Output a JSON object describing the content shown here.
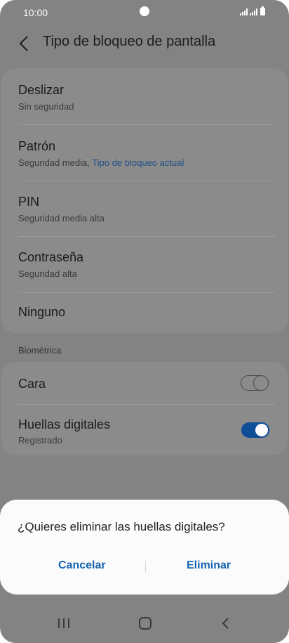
{
  "status": {
    "time": "10:00"
  },
  "header": {
    "title": "Tipo de bloqueo de pantalla"
  },
  "lock_types": [
    {
      "title": "Deslizar",
      "subtitle": "Sin seguridad"
    },
    {
      "title": "Patrón",
      "subtitle": "Seguridad media, ",
      "subtitle_accent": "Tipo de bloqueo actual"
    },
    {
      "title": "PIN",
      "subtitle": "Seguridad media alta"
    },
    {
      "title": "Contraseña",
      "subtitle": "Seguridad alta"
    },
    {
      "title": "Ninguno"
    }
  ],
  "biometrics": {
    "section_label": "Biométrica",
    "items": [
      {
        "title": "Cara",
        "enabled": false
      },
      {
        "title": "Huellas digitales",
        "subtitle": "Registrado",
        "enabled": true
      }
    ]
  },
  "dialog": {
    "message": "¿Quieres eliminar las huellas digitales?",
    "cancel_label": "Cancelar",
    "confirm_label": "Eliminar"
  },
  "navbar": {
    "icons": [
      "recent-apps-icon",
      "home-icon",
      "back-icon"
    ]
  },
  "colors": {
    "accent": "#1765b0",
    "toggle_on": "#0f4d97",
    "scrim": "#838383"
  }
}
